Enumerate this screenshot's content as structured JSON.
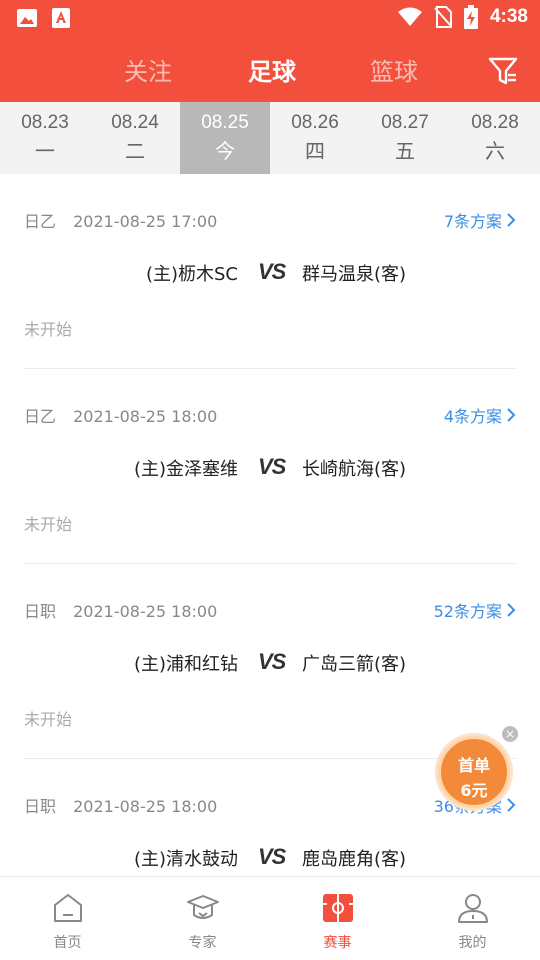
{
  "status_bar": {
    "time": "4:38"
  },
  "header": {
    "tabs": [
      {
        "label": "关注",
        "active": false
      },
      {
        "label": "足球",
        "active": true
      },
      {
        "label": "篮球",
        "active": false
      }
    ]
  },
  "dates": [
    {
      "date": "08.23",
      "weekday": "一",
      "active": false
    },
    {
      "date": "08.24",
      "weekday": "二",
      "active": false
    },
    {
      "date": "08.25",
      "weekday": "今",
      "active": true
    },
    {
      "date": "08.26",
      "weekday": "四",
      "active": false
    },
    {
      "date": "08.27",
      "weekday": "五",
      "active": false
    },
    {
      "date": "08.28",
      "weekday": "六",
      "active": false
    }
  ],
  "matches": [
    {
      "league": "日乙",
      "time": "2021-08-25 17:00",
      "plans": "7条方案",
      "home": "(主)枥木SC",
      "vs": "VS",
      "away": "群马温泉(客)",
      "status": "未开始"
    },
    {
      "league": "日乙",
      "time": "2021-08-25 18:00",
      "plans": "4条方案",
      "home": "(主)金泽塞维",
      "vs": "VS",
      "away": "长崎航海(客)",
      "status": "未开始"
    },
    {
      "league": "日职",
      "time": "2021-08-25 18:00",
      "plans": "52条方案",
      "home": "(主)浦和红钻",
      "vs": "VS",
      "away": "广岛三箭(客)",
      "status": "未开始"
    },
    {
      "league": "日职",
      "time": "2021-08-25 18:00",
      "plans": "36条方案",
      "home": "(主)清水鼓动",
      "vs": "VS",
      "away": "鹿岛鹿角(客)",
      "status": ""
    }
  ],
  "promo": {
    "line1": "首单",
    "line2": "6元"
  },
  "bottom_nav": [
    {
      "label": "首页",
      "icon": "home-icon",
      "active": false
    },
    {
      "label": "专家",
      "icon": "expert-icon",
      "active": false
    },
    {
      "label": "赛事",
      "icon": "match-icon",
      "active": true
    },
    {
      "label": "我的",
      "icon": "profile-icon",
      "active": false
    }
  ],
  "colors": {
    "primary": "#f24f3c",
    "link": "#3a8ee6",
    "promo": "#f28a3a"
  }
}
